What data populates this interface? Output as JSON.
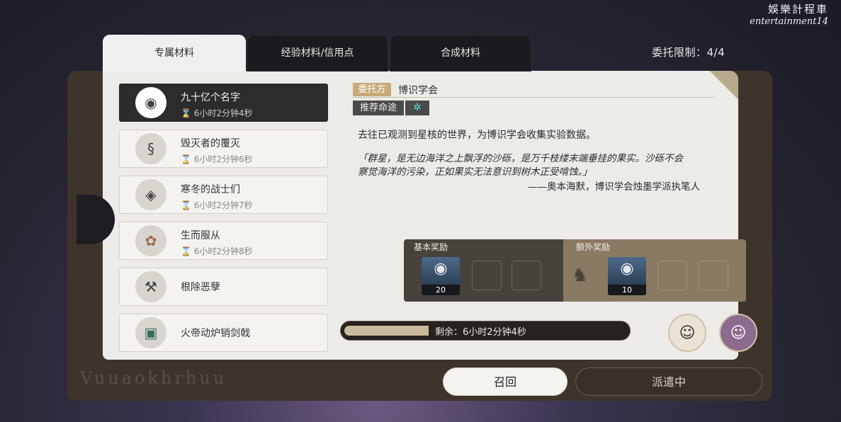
{
  "watermark": {
    "line1": "娛樂計程車",
    "line2": "entertainment14"
  },
  "tabs": [
    {
      "label": "专属材料",
      "active": true
    },
    {
      "label": "经验材料/信用点",
      "active": false
    },
    {
      "label": "合成材料",
      "active": false
    }
  ],
  "limit": "委托限制：4/4",
  "panel_decor_text": "Vuuaokhrhuu",
  "list": [
    {
      "name": "九十亿个名字",
      "time": "6小时2分钟4秒",
      "selected": true,
      "icon": "mask-icon"
    },
    {
      "name": "毁灭者的覆灭",
      "time": "6小时2分钟6秒",
      "selected": false,
      "icon": "claw-icon"
    },
    {
      "name": "寒冬的战士们",
      "time": "6小时2分钟7秒",
      "selected": false,
      "icon": "shield-icon"
    },
    {
      "name": "生而服从",
      "time": "6小时2分钟8秒",
      "selected": false,
      "icon": "gear-icon"
    },
    {
      "name": "根除恶孽",
      "time": "",
      "selected": false,
      "icon": "tool-icon"
    },
    {
      "name": "火帝动炉销剑戟",
      "time": "",
      "selected": false,
      "icon": "furnace-icon"
    }
  ],
  "detail": {
    "client_tag": "委托方",
    "client_name": "博识学会",
    "path_tag": "推荐命途",
    "description": "去往已观测到星核的世界，为博识学会收集实验数据。",
    "quote_line1": "「群星，是无边海洋之上飘浮的沙砾，是万千枝缕末端垂挂的果实。沙砾不会",
    "quote_line2": "察觉海洋的污染，正如果实无法意识到树木正受啃蚀。」",
    "quote_by": "——奥本海默，博识学会烛墨学派执笔人"
  },
  "rewards": {
    "basic_label": "基本奖励",
    "basic_count": "20",
    "extra_label": "额外奖励",
    "extra_count": "10"
  },
  "progress": {
    "text": "剩余：6小时2分钟4秒",
    "fraction": 0.3
  },
  "buttons": {
    "recall": "召回",
    "dispatch": "派遣中"
  },
  "colors": {
    "accent_gold": "#c7a97a",
    "selected_bg": "#2c2c2e",
    "path_icon": "#5de1c9"
  }
}
